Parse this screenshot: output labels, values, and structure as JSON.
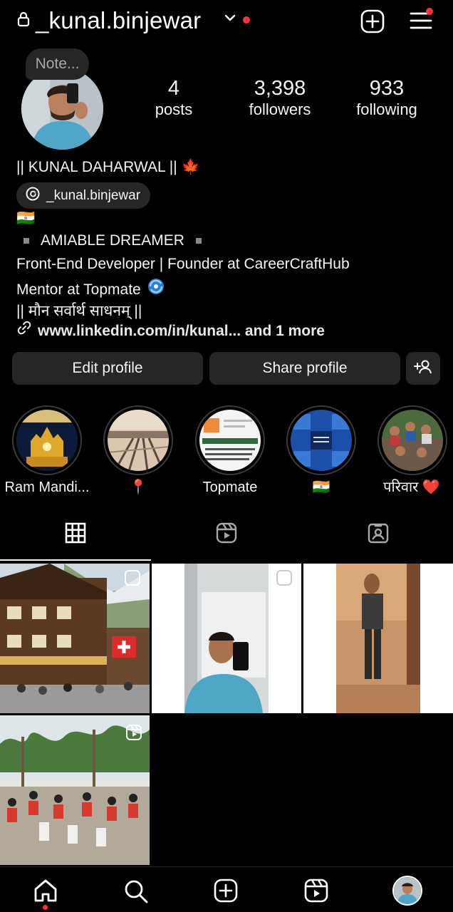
{
  "header": {
    "username": "_kunal.binjewar",
    "has_notification_dot": true
  },
  "profile": {
    "note_bubble": "Note...",
    "stats": [
      {
        "value": "4",
        "label": "posts"
      },
      {
        "value": "3,398",
        "label": "followers"
      },
      {
        "value": "933",
        "label": "following"
      }
    ],
    "name": "|| KUNAL DAHARWAL ||",
    "name_emoji": "🍁",
    "threads_handle": "_kunal.binjewar",
    "bio": {
      "flag": "🇮🇳",
      "tagline": "AMIABLE DREAMER",
      "line1": "Front-End Developer | Founder at CareerCraftHub",
      "line2": "Mentor at Topmate",
      "line3": "|| मौन सर्वार्थ साधनम् ||"
    },
    "link": "www.linkedin.com/in/kunal... and 1 more"
  },
  "buttons": {
    "edit": "Edit profile",
    "share": "Share profile"
  },
  "highlights": [
    {
      "label": "Ram Mandi..."
    },
    {
      "label": "📍"
    },
    {
      "label": "Topmate"
    },
    {
      "label": "🇮🇳"
    },
    {
      "label": "परिवार ❤️"
    }
  ],
  "tabs": [
    "grid-icon",
    "reels-icon",
    "tagged-icon"
  ],
  "colors": {
    "background": "#000000",
    "surface": "#262626",
    "text": "#f5f5f5",
    "notification": "#ff3040"
  }
}
